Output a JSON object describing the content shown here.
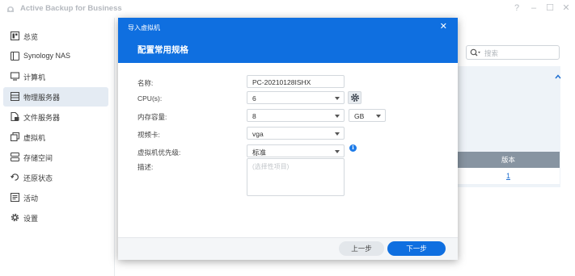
{
  "app": {
    "title": "Active Backup for Business",
    "window_controls": [
      "?",
      "–",
      "☐",
      "✕"
    ]
  },
  "sidebar": {
    "items": [
      {
        "label": "总览",
        "icon": "overview-icon",
        "active": false
      },
      {
        "label": "Synology NAS",
        "icon": "nas-icon",
        "active": false
      },
      {
        "label": "计算机",
        "icon": "computer-icon",
        "active": false
      },
      {
        "label": "物理服务器",
        "icon": "server-icon",
        "active": true
      },
      {
        "label": "文件服务器",
        "icon": "file-server-icon",
        "active": false
      },
      {
        "label": "虚拟机",
        "icon": "vm-icon",
        "active": false
      },
      {
        "label": "存储空间",
        "icon": "storage-icon",
        "active": false
      },
      {
        "label": "还原状态",
        "icon": "restore-icon",
        "active": false
      },
      {
        "label": "活动",
        "icon": "activity-icon",
        "active": false
      },
      {
        "label": "设置",
        "icon": "settings-icon",
        "active": false
      }
    ]
  },
  "main": {
    "search_placeholder": "搜索",
    "table_header": "版本",
    "table_value": "1"
  },
  "modal": {
    "subtitle": "导入虚拟机",
    "title": "配置常用规格",
    "fields": {
      "name": {
        "label": "名称:",
        "value": "PC-20210128ISHX"
      },
      "cpu": {
        "label": "CPU(s):",
        "value": "6"
      },
      "memory": {
        "label": "内存容量:",
        "value": "8",
        "unit": "GB"
      },
      "video": {
        "label": "视频卡:",
        "value": "vga"
      },
      "priority": {
        "label": "虚拟机优先级:",
        "value": "标准"
      },
      "description": {
        "label": "描述:",
        "placeholder": "(选择性项目)"
      }
    },
    "info_glyph": "i",
    "buttons": {
      "prev": "上一步",
      "next": "下一步"
    }
  },
  "colors": {
    "accent": "#0f6fe0",
    "sidebar_active": "#e4ebf3",
    "table_header": "#8794a1"
  }
}
